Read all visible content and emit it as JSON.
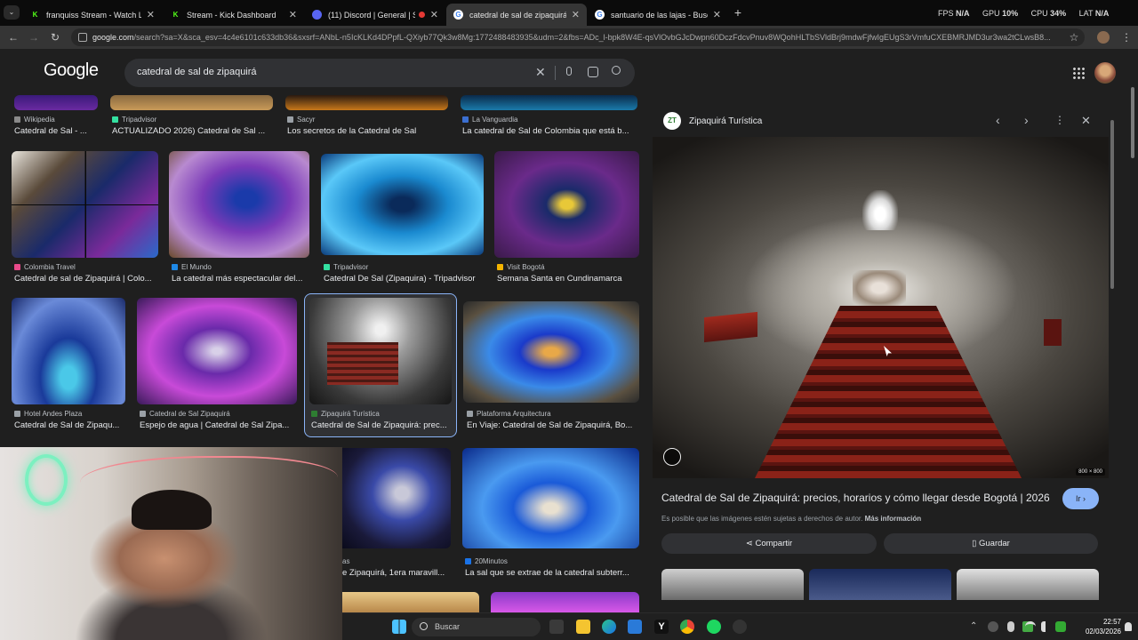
{
  "browser": {
    "tabs": [
      {
        "title": "franquiss Stream - Watch Live o",
        "favicon_color": "#53fc18",
        "active": false
      },
      {
        "title": "Stream - Kick Dashboard",
        "favicon_color": "#53fc18",
        "active": false
      },
      {
        "title": "(11) Discord | General | Soy",
        "favicon_color": "#5865f2",
        "active": false
      },
      {
        "title": "catedral de sal de zipaquirá - B",
        "favicon_color": "#4285f4",
        "active": true
      },
      {
        "title": "santuario de las lajas - Buscar c",
        "favicon_color": "#4285f4",
        "active": false
      }
    ],
    "new_tab": "+",
    "url_host": "google.com",
    "url_rest": "/search?sa=X&sca_esv=4c4e6101c633db36&sxsrf=ANbL-n5IcKLKd4DPpfL-QXiyb77Qk3w8Mg:1772488483935&udm=2&fbs=ADc_l-bpk8W4E-qsVlOvbGJcDwpn60DczFdcvPnuv8WQohHLTbSVldBrj9mdwFjfwIgEUgS3rVmfuCXEBMRJMD3ur3wa2tCLwsB8..."
  },
  "overlay": {
    "fps_label": "FPS",
    "fps_value": "N/A",
    "gpu_label": "GPU",
    "gpu_value": "10%",
    "cpu_label": "CPU",
    "cpu_value": "34%",
    "lat_label": "LAT",
    "lat_value": "N/A"
  },
  "google": {
    "logo": "Google",
    "query": "catedral de sal de zipaquirá"
  },
  "results_row0": [
    {
      "source": "Wikipedia",
      "caption": "Catedral de Sal - ...",
      "color": "#8a8a8a"
    },
    {
      "source": "Tripadvisor",
      "caption": "ACTUALIZADO 2026) Catedral de Sal ...",
      "color": "#34e0a1"
    },
    {
      "source": "Sacyr",
      "caption": "Los secretos de la Catedral de Sal",
      "color": "#9aa0a6"
    },
    {
      "source": "La Vanguardia",
      "caption": "La catedral de Sal de Colombia que está b...",
      "color": "#3b6fd1"
    }
  ],
  "results_row1": [
    {
      "source": "Colombia Travel",
      "caption": "Catedral de sal de Zipaquirá | Colo...",
      "color": "#e84a8a"
    },
    {
      "source": "El Mundo",
      "caption": "La catedral más espectacular del...",
      "color": "#1e88e5"
    },
    {
      "source": "Tripadvisor",
      "caption": "Catedral De Sal (Zipaquira) - Tripadvisor",
      "color": "#34e0a1"
    },
    {
      "source": "Visit Bogotá",
      "caption": "Semana Santa en Cundinamarca",
      "color": "#f4b400"
    }
  ],
  "results_row2": [
    {
      "source": "Hotel Andes Plaza",
      "caption": "Catedral de Sal de Zipaqu...",
      "color": "#9aa0a6"
    },
    {
      "source": "Catedral de Sal Zipaquirá",
      "caption": "Espejo de agua | Catedral de Sal Zipa...",
      "color": "#9aa0a6"
    },
    {
      "source": "Zipaquirá Turística",
      "caption": "Catedral de Sal de Zipaquirá: prec...",
      "color": "#2e7d32"
    },
    {
      "source": "Plataforma Arquitectura",
      "caption": "En Viaje: Catedral de Sal de Zipaquirá, Bo...",
      "color": "#9aa0a6"
    }
  ],
  "results_row3": [
    {
      "source": "as",
      "caption": "e Zipaquirá, 1era maravill...",
      "color": "#9aa0a6"
    },
    {
      "source": "20Minutos",
      "caption": "La sal que se extrae de la catedral subterr...",
      "color": "#1a73e8"
    }
  ],
  "panel": {
    "site_name": "Zipaquirá Turística",
    "site_badge": "ZT",
    "image_size": "800 × 800",
    "title": "Catedral de Sal de Zipaquirá: precios, horarios y cómo llegar desde Bogotá | 2026",
    "visit_label": "Ir",
    "copyright": "Es posible que las imágenes estén sujetas a derechos de autor.",
    "more_info": "Más información",
    "share_label": "Compartir",
    "save_label": "Guardar"
  },
  "taskbar": {
    "search_placeholder": "Buscar",
    "time": "22:57",
    "date": "02/03/2026"
  }
}
